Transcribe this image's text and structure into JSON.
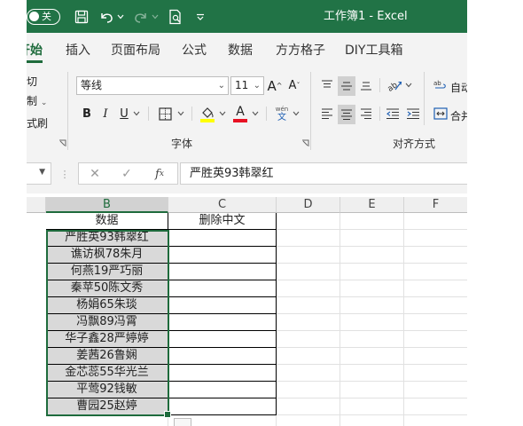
{
  "titlebar": {
    "autosave_label": "关",
    "title": "工作簿1 - Excel",
    "accent": "#217346"
  },
  "tabs": [
    "开始",
    "插入",
    "页面布局",
    "公式",
    "数据",
    "方方格子",
    "DIY工具箱"
  ],
  "clipboard": {
    "items": [
      "剪切",
      "复制",
      "格式刷"
    ]
  },
  "font": {
    "name": "等线",
    "size": "11",
    "group_label": "字体",
    "bold": "B",
    "italic": "I",
    "underline": "U",
    "phonetic_top": "wén",
    "phonetic_bottom": "文",
    "font_color": "#e81123",
    "fill_color": "#ffff00"
  },
  "alignment": {
    "group_label": "对齐方式",
    "wrap_label": "自动",
    "merge_label": "合并"
  },
  "formula_bar": {
    "content": "严胜英93韩翠红"
  },
  "grid": {
    "columns": [
      "B",
      "C",
      "D",
      "E",
      "F"
    ],
    "selected_column": "B",
    "header_b": "数据",
    "header_c": "删除中文",
    "rows": [
      "严胜英93韩翠红",
      "谯访枫78朱月",
      "何燕19严巧丽",
      "秦苹50陈文秀",
      "杨娟65朱琰",
      "冯飘89冯霄",
      "华子鑫28严婷婷",
      "姜茜26鲁娴",
      "金芯蕊55华光兰",
      "平莺92钱敏",
      "曹园25赵婷"
    ]
  }
}
